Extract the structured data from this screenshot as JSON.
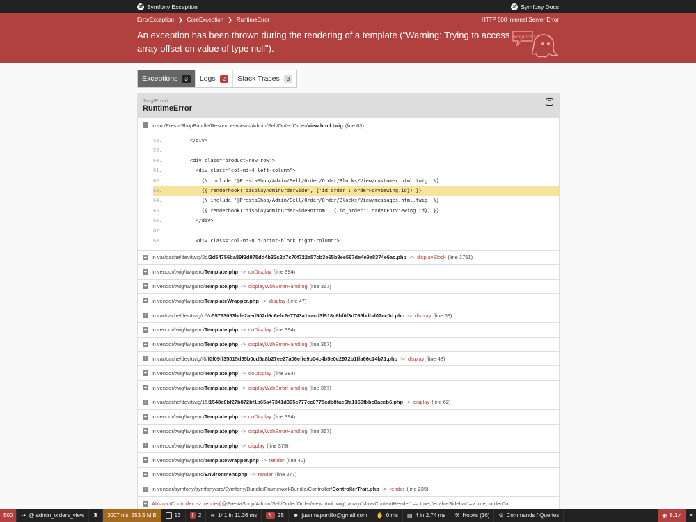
{
  "topbar": {
    "brand": "Symfony Exception",
    "docs": "Symfony Docs"
  },
  "crumbs": [
    "ErrorException",
    "CoreException",
    "RuntimeError"
  ],
  "http_status": "HTTP 500 Internal Server Error",
  "message": "An exception has been thrown during the rendering of a template (\"Warning: Trying to access array offset on value of type null\").",
  "ghost_label": "Exception!",
  "tabs": [
    {
      "label": "Exceptions",
      "count": "3"
    },
    {
      "label": "Logs",
      "count": "2"
    },
    {
      "label": "Stack Traces",
      "count": "3"
    }
  ],
  "exception": {
    "class": "Twig\\Error\\",
    "name": "RuntimeError"
  },
  "first_trace": {
    "prefix": "in src/PrestaShopBundle/Resources/views/Admin/Sell/Order/Order/",
    "file": "view.html.twig",
    "line": "(line 63)"
  },
  "code_lines": [
    {
      "num": "58.",
      "src": "    </div>"
    },
    {
      "num": "59.",
      "src": ""
    },
    {
      "num": "60.",
      "src": "    <div class=\"product-row row\">"
    },
    {
      "num": "61.",
      "src": "      <div class=\"col-md-4 left-column\">"
    },
    {
      "num": "62.",
      "src": "        {% include '@PrestaShop/Admin/Sell/Order/Order/Blocks/View/customer.html.twig' %}"
    },
    {
      "num": "63.",
      "src": "        {{ renderhook('displayAdminOrderSide', {'id_order': orderForViewing.id}) }}"
    },
    {
      "num": "64.",
      "src": "        {% include '@PrestaShop/Admin/Sell/Order/Order/Blocks/View/messages.html.twig' %}"
    },
    {
      "num": "65.",
      "src": "        {{ renderhook('displayAdminOrderSideBottom', {'id_order': orderForViewing.id}) }}"
    },
    {
      "num": "66.",
      "src": "      </div>"
    },
    {
      "num": "67.",
      "src": ""
    },
    {
      "num": "68.",
      "src": "      <div class=\"col-md-8 d-print-block right-column\">"
    }
  ],
  "traces": [
    {
      "prefix": "in var/cache/dev/twig/2d/",
      "file": "2d54756ba89f3d975dd4b32c2d7c70f722a57cb3e65b8ee567de4e9a8374e6ac.php",
      "fn": "displayBlock",
      "line": "(line 1751)"
    },
    {
      "prefix": "in vendor/twig/twig/src/",
      "file": "Template.php",
      "fn": "doDisplay",
      "line": "(line 394)"
    },
    {
      "prefix": "in vendor/twig/twig/src/",
      "file": "Template.php",
      "fn": "displayWithErrorHandling",
      "line": "(line 367)"
    },
    {
      "prefix": "in vendor/twig/twig/src/",
      "file": "TemplateWrapper.php",
      "fn": "display",
      "line": "(line 47)"
    },
    {
      "prefix": "in var/cache/dev/twig/c5/",
      "file": "c55793053bde2aed502d6c6efc2e7743a1aacd3f918c6bf6f3d765bdbd07cc0d.php",
      "fn": "display",
      "line": "(line 63)"
    },
    {
      "prefix": "in vendor/twig/twig/src/",
      "file": "Template.php",
      "fn": "doDisplay",
      "line": "(line 394)"
    },
    {
      "prefix": "in vendor/twig/twig/src/",
      "file": "Template.php",
      "fn": "displayWithErrorHandling",
      "line": "(line 367)"
    },
    {
      "prefix": "in var/cache/dev/twig/f0/",
      "file": "f0f09ff35015d55b0cd5a8b27ee27a06effe9b04c4b5e0c2972b1ffa66c14b71.php",
      "fn": "display",
      "line": "(line 48)"
    },
    {
      "prefix": "in vendor/twig/twig/src/",
      "file": "Template.php",
      "fn": "doDisplay",
      "line": "(line 394)"
    },
    {
      "prefix": "in vendor/twig/twig/src/",
      "file": "Template.php",
      "fn": "displayWithErrorHandling",
      "line": "(line 367)"
    },
    {
      "prefix": "in var/cache/dev/twig/15/",
      "file": "1548c0bf27b872bf1b65a47341d395c777cc0775cdb8fac6fa1366fbbc8aeeb6.php",
      "fn": "display",
      "line": "(line 62)"
    },
    {
      "prefix": "in vendor/twig/twig/src/",
      "file": "Template.php",
      "fn": "doDisplay",
      "line": "(line 394)"
    },
    {
      "prefix": "in vendor/twig/twig/src/",
      "file": "Template.php",
      "fn": "displayWithErrorHandling",
      "line": "(line 367)"
    },
    {
      "prefix": "in vendor/twig/twig/src/",
      "file": "Template.php",
      "fn": "display",
      "line": "(line 379)"
    },
    {
      "prefix": "in vendor/twig/twig/src/",
      "file": "TemplateWrapper.php",
      "fn": "render",
      "line": "(line 40)"
    },
    {
      "prefix": "in vendor/twig/twig/src/",
      "file": "Environment.php",
      "fn": "render",
      "line": "(line 277)"
    },
    {
      "prefix": "in vendor/symfony/symfony/src/Symfony/Bundle/FrameworkBundle/Controller/",
      "file": "ControllerTrait.php",
      "fn": "render",
      "line": "(line 235)"
    }
  ],
  "last_trace": {
    "prefix": "AbstractController",
    "fn": "render",
    "rest": "('@PrestaShop/Admin/Sell/Order/Order/view.html.twig', array('showContentHeader' => true, 'enableSidebar' => true, 'orderCur..."
  },
  "toolbar": {
    "status": "500",
    "route": "@ admin_orders_view",
    "time": "3007 ms",
    "memory": "253.5 MiB",
    "forms": "13",
    "errors": "2",
    "db": "141 in 11.36 ms",
    "twig": "25",
    "user": "juanmaportillo@gmail.com",
    "events_time": "0 ms",
    "cache": "4 in 2.74 ms",
    "hooks": "Hooks (16)",
    "commands": "Commands / Queries",
    "version": "8.1.4"
  }
}
